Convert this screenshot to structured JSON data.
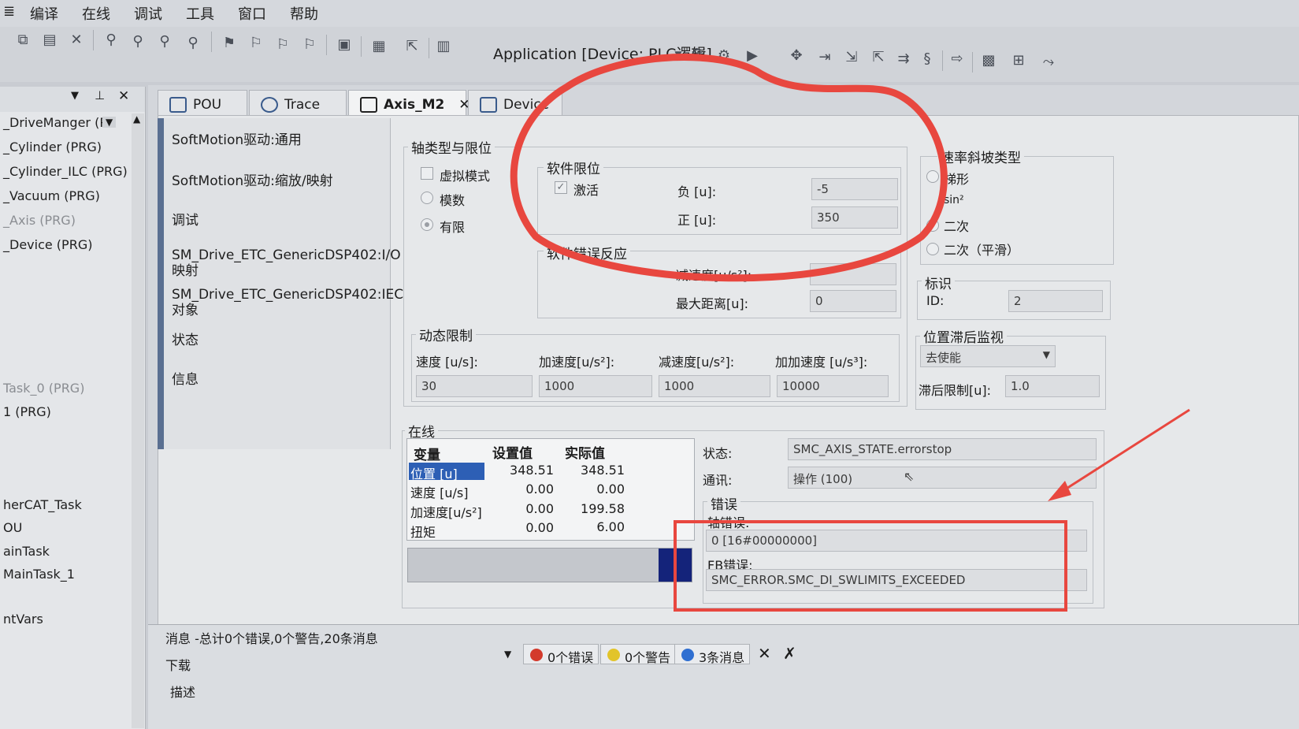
{
  "menu": [
    "编译",
    "在线",
    "调试",
    "工具",
    "窗口",
    "帮助"
  ],
  "toolbar": {
    "app_title": "Application [Device: PLC逻辑]"
  },
  "tree": {
    "items": [
      {
        "label": "_DriveManger (PR",
        "dim": false
      },
      {
        "label": "_Cylinder (PRG)",
        "dim": false
      },
      {
        "label": "_Cylinder_ILC (PRG)",
        "dim": false
      },
      {
        "label": "_Vacuum (PRG)",
        "dim": false
      },
      {
        "label": "_Axis (PRG)",
        "dim": true
      },
      {
        "label": "_Device (PRG)",
        "dim": false
      },
      {
        "label": "Task_0 (PRG)",
        "dim": true
      },
      {
        "label": "1 (PRG)",
        "dim": false
      },
      {
        "label": "herCAT_Task",
        "dim": false
      },
      {
        "label": "OU",
        "dim": false
      },
      {
        "label": "ainTask",
        "dim": false
      },
      {
        "label": "MainTask_1",
        "dim": false
      },
      {
        "label": "ntVars",
        "dim": false
      }
    ]
  },
  "tabs": [
    {
      "label": "POU"
    },
    {
      "label": "Trace"
    },
    {
      "label": "Axis_M2"
    },
    {
      "label": "Device"
    }
  ],
  "sidenav": [
    "SoftMotion驱动:通用",
    "SoftMotion驱动:缩放/映射",
    "调试",
    "SM_Drive_ETC_GenericDSP402:I/O 映射",
    "SM_Drive_ETC_GenericDSP402:IEC 对象",
    "状态",
    "信息"
  ],
  "axis_type": {
    "title": "轴类型与限位",
    "virtual": "虚拟模式",
    "modulo": "模数",
    "finite": "有限"
  },
  "sw_limits": {
    "title": "软件限位",
    "active_label": "激活",
    "neg_label": "负 [u]:",
    "neg_value": "-5",
    "pos_label": "正 [u]:",
    "pos_value": "350"
  },
  "sw_error": {
    "title": "软件错误反应",
    "decel_label": "减速度[u/s²]:",
    "maxdist_label": "最大距离[u]:",
    "maxdist_value": "0"
  },
  "ramp": {
    "title": "速率斜坡类型",
    "opt1": "梯形",
    "opt2": "sin²",
    "opt3": "二次",
    "opt4": "二次（平滑）"
  },
  "ident": {
    "title": "标识",
    "id_label": "ID:",
    "id_value": "2"
  },
  "dynamics": {
    "title": "动态限制",
    "vel_label": "速度 [u/s]:",
    "vel": "30",
    "acc_label": "加速度[u/s²]:",
    "acc": "1000",
    "dec_label": "减速度[u/s²]:",
    "dec": "1000",
    "jerk_label": "加加速度 [u/s³]:",
    "jerk": "10000"
  },
  "lag": {
    "title": "位置滞后监视",
    "mode": "去使能",
    "limit_label": "滞后限制[u]:",
    "limit": "1.0"
  },
  "online": {
    "title": "在线",
    "headers": [
      "变量",
      "设置值",
      "实际值"
    ],
    "rows": [
      {
        "var": "位置 [u]",
        "set": "348.51",
        "act": "348.51"
      },
      {
        "var": "速度 [u/s]",
        "set": "0.00",
        "act": "0.00"
      },
      {
        "var": "加速度[u/s²]",
        "set": "0.00",
        "act": "199.58"
      },
      {
        "var": "扭矩",
        "set": "0.00",
        "act": "6.00"
      }
    ],
    "state_label": "状态:",
    "state_value": "SMC_AXIS_STATE.errorstop",
    "comm_label": "通讯:",
    "comm_value": "操作 (100)",
    "errors_title": "错误",
    "axis_err_label": "轴错误:",
    "axis_err_value": "0 [16#00000000]",
    "fb_err_label": "FB错误:",
    "fb_err_value": "SMC_ERROR.SMC_DI_SWLIMITS_EXCEEDED"
  },
  "messages": {
    "summary": "消息 -总计0个错误,0个警告,20条消息",
    "source": "下载",
    "errors_btn": "0个错误",
    "warnings_btn": "0个警告",
    "info_btn": "3条消息",
    "desc_header": "描述"
  },
  "colors": {
    "annotation_red": "#e8473f",
    "selection_blue": "#2d5fb5",
    "progress_fill": "#14237a"
  }
}
